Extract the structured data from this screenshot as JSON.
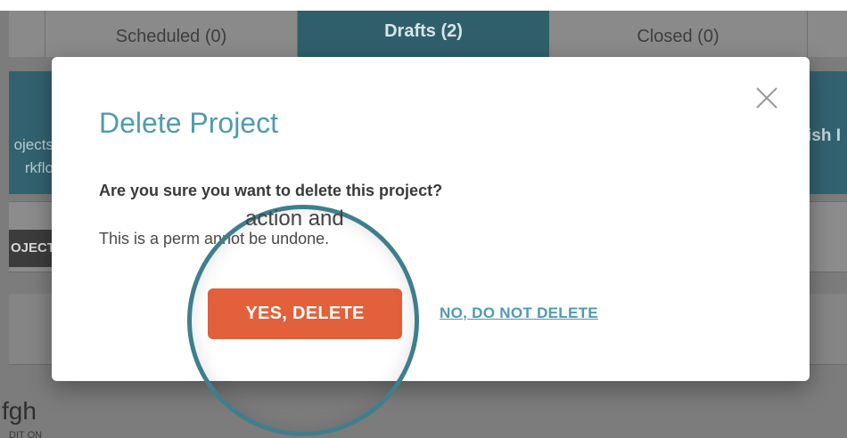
{
  "tabs": [
    {
      "label": "Scheduled (0)"
    },
    {
      "label": "Drafts (2)"
    },
    {
      "label": "Closed (0)"
    }
  ],
  "background": {
    "band_left_lines": [
      "ojects",
      "rkflo"
    ],
    "band_right": "ish I",
    "project_button": "OJECT",
    "project_name": "fgh",
    "project_sub": "DIT ON"
  },
  "modal": {
    "title": "Delete Project",
    "question": "Are you sure you want to delete this project?",
    "detail": "This is a perm                           annot be undone.",
    "magnified_text": "action and",
    "yes_label": "YES, DELETE",
    "no_label": "NO, DO NOT DELETE",
    "close_icon": "close-icon"
  },
  "colors": {
    "accent": "#4f9bb0",
    "danger": "#e2603a",
    "tab_active": "#305f6c"
  }
}
